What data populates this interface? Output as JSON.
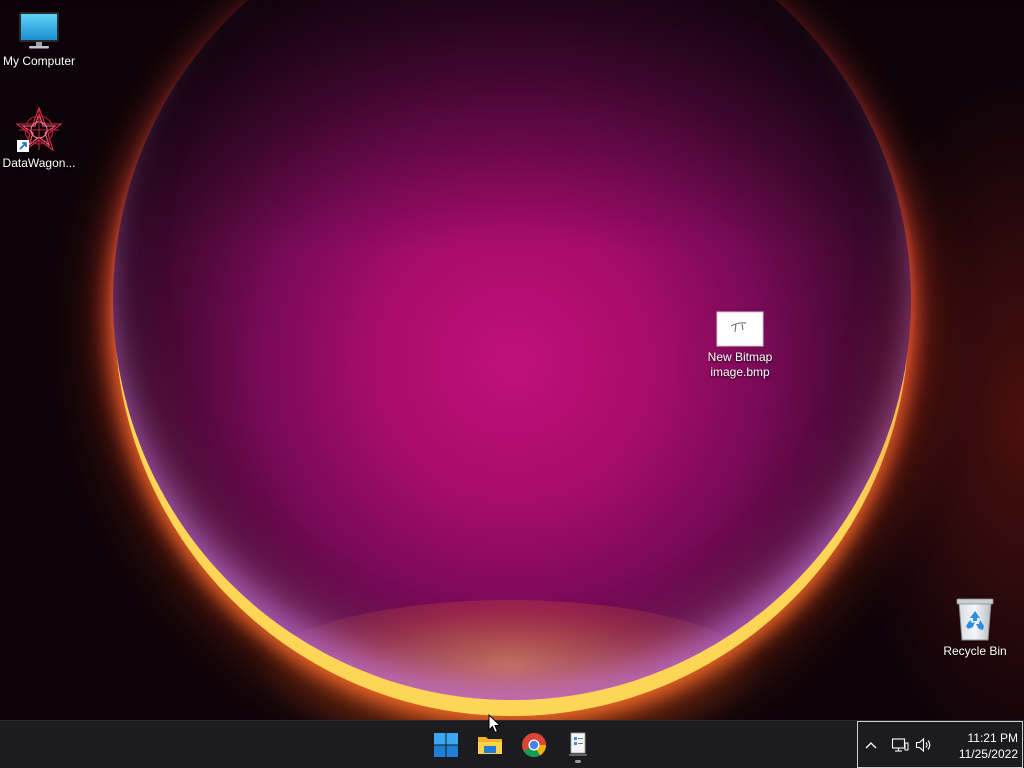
{
  "desktop": {
    "icons": [
      {
        "label": "My Computer",
        "icon": "monitor-icon"
      },
      {
        "label": "DataWagon...",
        "icon": "datawagon-shortcut-icon"
      },
      {
        "label": "New Bitmap image.bmp",
        "icon": "bitmap-file-icon"
      },
      {
        "label": "Recycle Bin",
        "icon": "recycle-bin-icon"
      }
    ]
  },
  "taskbar": {
    "apps": [
      {
        "name": "Start",
        "icon": "windows-logo-icon"
      },
      {
        "name": "File Explorer",
        "icon": "folder-icon"
      },
      {
        "name": "Google Chrome",
        "icon": "chrome-icon"
      },
      {
        "name": "Notepad-like app",
        "icon": "app-document-icon",
        "running": true
      }
    ],
    "tray": {
      "overflow_icon": "chevron-up-icon",
      "network_icon": "network-icon",
      "volume_icon": "speaker-icon",
      "time": "11:21 PM",
      "date": "11/25/2022"
    }
  },
  "colors": {
    "taskbar_bg": "#1c1c20",
    "accent_blue": "#1e90ff"
  }
}
